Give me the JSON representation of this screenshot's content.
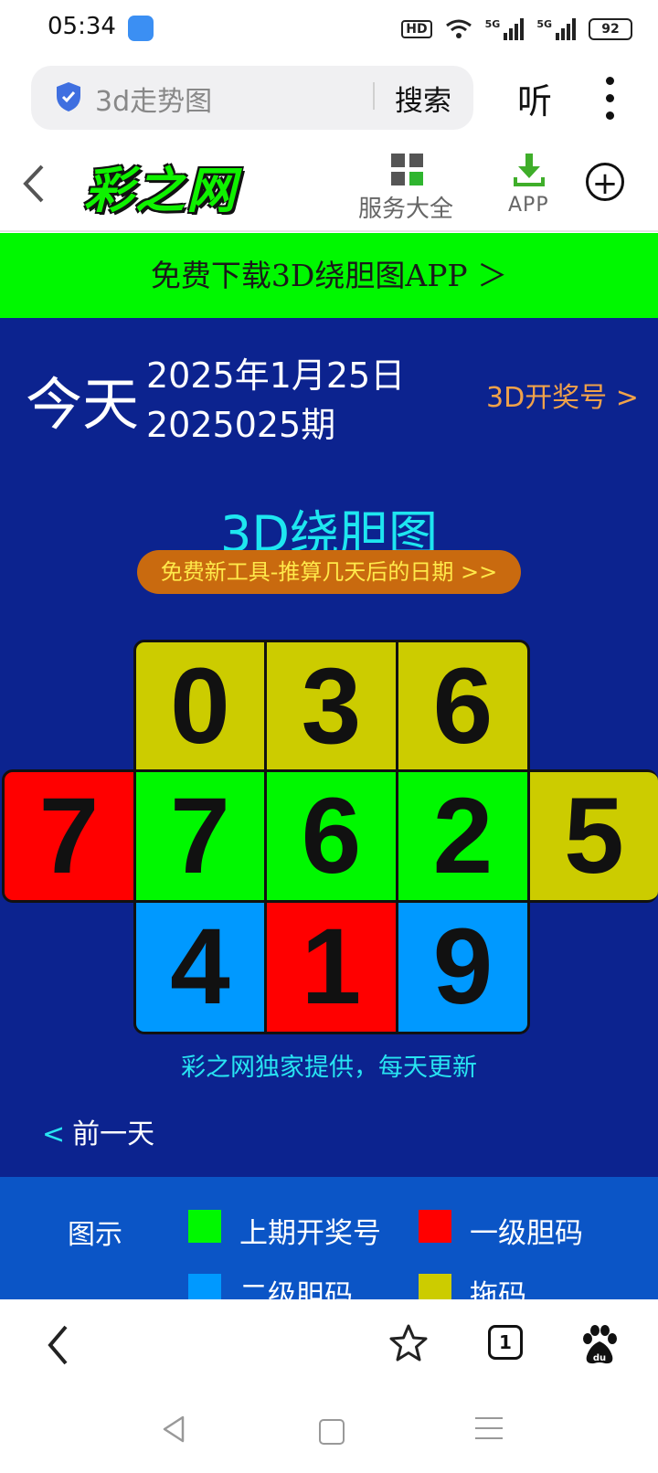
{
  "status_bar": {
    "time": "05:34",
    "hd_label": "HD",
    "net1": "5G",
    "net2": "5G",
    "battery": "92"
  },
  "search_bar": {
    "query": "3d走势图",
    "search_label": "搜索",
    "listen_label": "听"
  },
  "site_header": {
    "logo": "彩之网",
    "service_label": "服务大全",
    "app_label": "APP",
    "add_symbol": "+"
  },
  "banner": {
    "text": "免费下载3D绕胆图APP ＞"
  },
  "date_block": {
    "today": "今天",
    "date": "2025年1月25日",
    "issue": "2025025期",
    "kaijiang_link": "3D开奖号 >"
  },
  "chart": {
    "title": "3D绕胆图",
    "tool_pill": "免费新工具-推算几天后的日期 >>",
    "row_top": [
      "0",
      "3",
      "6"
    ],
    "row_middle": [
      "7",
      "7",
      "6",
      "2",
      "5"
    ],
    "row_bottom": [
      "4",
      "1",
      "9"
    ],
    "credit": "彩之网独家提供，每天更新"
  },
  "prev_day": {
    "arrow": "<",
    "label": "前一天"
  },
  "legend": {
    "title": "图示",
    "items": [
      {
        "label": "上期开奖号",
        "color": "#00f800"
      },
      {
        "label": "一级胆码",
        "color": "#ff0000"
      },
      {
        "label": "二级胆码",
        "color": "#0099ff"
      },
      {
        "label": "拖码",
        "color": "#cccc00"
      }
    ]
  },
  "bottom_nav": {
    "tab_count": "1"
  },
  "colors": {
    "yellow": "#cccc00",
    "green": "#00f800",
    "red": "#ff0000",
    "blue": "#0099ff",
    "main_bg": "#0c238f",
    "legend_bg": "#0b55c6"
  }
}
